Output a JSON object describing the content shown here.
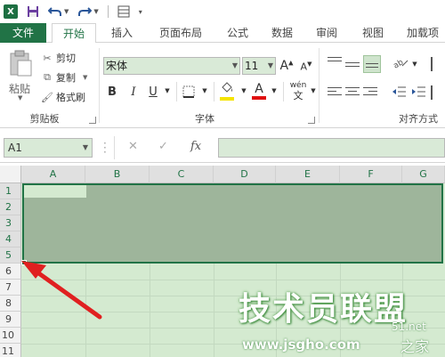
{
  "app": {
    "logo_text": "X"
  },
  "qat": {
    "save_icon": "save-icon",
    "undo_icon": "undo-icon",
    "redo_icon": "redo-icon",
    "form_icon": "form-icon",
    "more_icon": "customize-icon"
  },
  "tabs": [
    {
      "label": "文件"
    },
    {
      "label": "开始"
    },
    {
      "label": "插入"
    },
    {
      "label": "页面布局"
    },
    {
      "label": "公式"
    },
    {
      "label": "数据"
    },
    {
      "label": "审阅"
    },
    {
      "label": "视图"
    },
    {
      "label": "加载项"
    }
  ],
  "clipboard": {
    "paste_label": "粘贴",
    "cut_label": "剪切",
    "copy_label": "复制",
    "format_painter_label": "格式刷",
    "group_label": "剪贴板"
  },
  "font": {
    "font_name": "宋体",
    "font_size": "11",
    "bold": "B",
    "italic": "I",
    "underline": "U",
    "grow": "A",
    "shrink": "A",
    "phonetic_top": "wén",
    "phonetic_bottom": "文",
    "font_color_letter": "A",
    "group_label": "字体"
  },
  "alignment": {
    "group_label": "对齐方式"
  },
  "formula_bar": {
    "name_box": "A1",
    "cancel": "✕",
    "enter": "✓",
    "fx": "fx",
    "value": ""
  },
  "grid": {
    "columns": [
      "A",
      "B",
      "C",
      "D",
      "E",
      "F",
      "G"
    ],
    "rows": [
      "1",
      "2",
      "3",
      "4",
      "5",
      "6",
      "7",
      "8",
      "9",
      "10",
      "11"
    ],
    "selected_range": "A1:G5"
  },
  "watermark": {
    "main": "技术员联盟",
    "net": "51.net",
    "url": "www.jsgho.com",
    "home": "之家"
  },
  "colors": {
    "accent": "#217346",
    "selection": "#9eb59b",
    "sheet_bg": "#d4ead0",
    "arrow": "#e02020"
  }
}
